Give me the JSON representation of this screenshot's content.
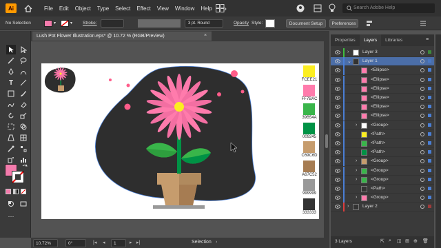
{
  "app": {
    "logo": "Ai",
    "home_icon": "home-icon"
  },
  "menu": [
    "File",
    "Edit",
    "Object",
    "Type",
    "Select",
    "Effect",
    "View",
    "Window",
    "Help"
  ],
  "search": {
    "placeholder": "Search Adobe Help"
  },
  "control_bar": {
    "selection_label": "No Selection",
    "stroke_label": "Stroke:",
    "brush_label": "3 pt. Round",
    "opacity_label": "Opacity",
    "style_label": "Style:",
    "document_setup": "Document Setup",
    "preferences": "Preferences",
    "fill_color": "#f47bac",
    "stroke_color": "#ffffff"
  },
  "document": {
    "tab_title": "Lush Pot Flower Illustration.eps* @ 10.72 % (RGB/Preview)"
  },
  "swatches": [
    {
      "hex": "#FCEE21",
      "label": "FCEE21"
    },
    {
      "hex": "#FF7BAC",
      "label": "FF7BAC"
    },
    {
      "hex": "#39B54A",
      "label": "39B54A"
    },
    {
      "hex": "#009245",
      "label": "009245"
    },
    {
      "hex": "#C69C6D",
      "label": "C69C6D"
    },
    {
      "hex": "#A67C52",
      "label": "A67C52"
    },
    {
      "hex": "#999999",
      "label": "999999"
    },
    {
      "hex": "#333333",
      "label": "333333"
    }
  ],
  "status": {
    "zoom": "10.72%",
    "rotation": "0°",
    "artboard": "1",
    "mode": "Selection"
  },
  "panel": {
    "tabs": [
      "Properties",
      "Layers",
      "Libraries"
    ],
    "active_tab": "Layers",
    "rows": [
      {
        "name": "Layer 3",
        "indent": 0,
        "arrow": "›",
        "color": "#3fbf3f",
        "thumb": "#ffffff",
        "selected": false
      },
      {
        "name": "Layer 1",
        "indent": 0,
        "arrow": "⌄",
        "color": "#4a7fd6",
        "thumb": "#333333",
        "selected": true
      },
      {
        "name": "<Ellipse>",
        "indent": 1,
        "arrow": "",
        "color": "#4a7fd6",
        "thumb": "#ff7bac",
        "selected": false
      },
      {
        "name": "<Ellipse>",
        "indent": 1,
        "arrow": "",
        "color": "#4a7fd6",
        "thumb": "#ff7bac",
        "selected": false
      },
      {
        "name": "<Ellipse>",
        "indent": 1,
        "arrow": "",
        "color": "#4a7fd6",
        "thumb": "#ff7bac",
        "selected": false
      },
      {
        "name": "<Ellipse>",
        "indent": 1,
        "arrow": "",
        "color": "#4a7fd6",
        "thumb": "#ff7bac",
        "selected": false
      },
      {
        "name": "<Ellipse>",
        "indent": 1,
        "arrow": "",
        "color": "#4a7fd6",
        "thumb": "#ff7bac",
        "selected": false
      },
      {
        "name": "<Ellipse>",
        "indent": 1,
        "arrow": "",
        "color": "#4a7fd6",
        "thumb": "#ff7bac",
        "selected": false
      },
      {
        "name": "<Group>",
        "indent": 1,
        "arrow": "›",
        "color": "#4a7fd6",
        "thumb": "#ffffff",
        "selected": false
      },
      {
        "name": "<Path>",
        "indent": 1,
        "arrow": "",
        "color": "#4a7fd6",
        "thumb": "#fcee21",
        "selected": false
      },
      {
        "name": "<Path>",
        "indent": 1,
        "arrow": "",
        "color": "#4a7fd6",
        "thumb": "#39b54a",
        "selected": false
      },
      {
        "name": "<Path>",
        "indent": 1,
        "arrow": "",
        "color": "#4a7fd6",
        "thumb": "#009245",
        "selected": false
      },
      {
        "name": "<Group>",
        "indent": 1,
        "arrow": "›",
        "color": "#4a7fd6",
        "thumb": "#c69c6d",
        "selected": false
      },
      {
        "name": "<Group>",
        "indent": 1,
        "arrow": "›",
        "color": "#4a7fd6",
        "thumb": "#39b54a",
        "selected": false
      },
      {
        "name": "<Group>",
        "indent": 1,
        "arrow": "›",
        "color": "#4a7fd6",
        "thumb": "#39b54a",
        "selected": false
      },
      {
        "name": "<Path>",
        "indent": 1,
        "arrow": "",
        "color": "#4a7fd6",
        "thumb": "#333333",
        "selected": false
      },
      {
        "name": "<Group>",
        "indent": 1,
        "arrow": "›",
        "color": "#4a7fd6",
        "thumb": "#ff7bac",
        "selected": false
      },
      {
        "name": "Layer 2",
        "indent": 0,
        "arrow": "›",
        "color": "#e03c3c",
        "thumb": "#333333",
        "selected": false
      }
    ],
    "footer_label": "3 Layers"
  }
}
